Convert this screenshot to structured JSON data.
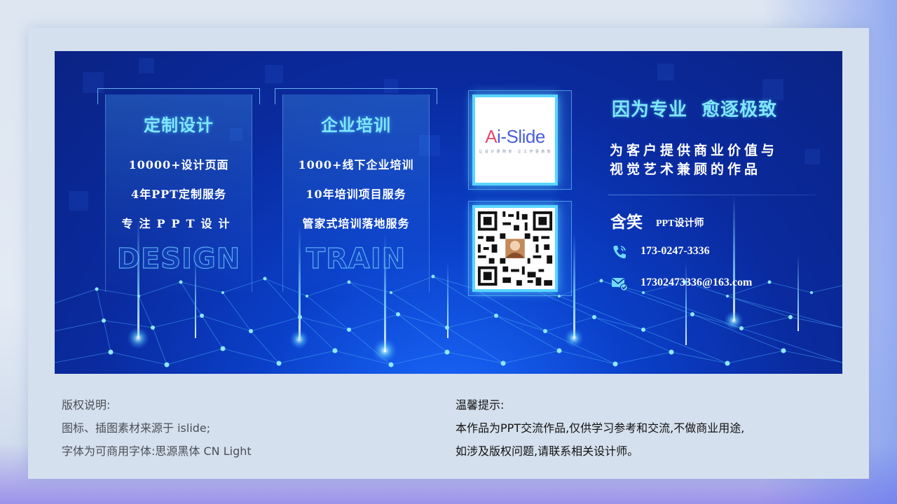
{
  "colors": {
    "banner_dark": "#0a2384",
    "banner_bright": "#1b6bff",
    "accent_cyan": "#7fe8ff",
    "glow": "#5ad6ff",
    "page_bg": "#d5e0ee"
  },
  "panels": [
    {
      "title": "定制设计",
      "lines": [
        "10000+设计页面",
        "4年PPT定制服务",
        "专注PPT设计"
      ],
      "watermark": "DESIGN"
    },
    {
      "title": "企业培训",
      "lines": [
        "1000+线下企业培训",
        "10年培训项目服务",
        "管家式培训落地服务"
      ],
      "watermark": "TRAIN"
    }
  ],
  "logo": {
    "text_a": "A",
    "text_rest": "i-Slide",
    "tagline": "让 设 计 更 简 单 · 让 工 作 更 高 效"
  },
  "qr": {
    "icon": "qr-code-icon"
  },
  "profile": {
    "slogan": "因为专业  愈逐极致",
    "value_lines": [
      "为客户提供商业价值与",
      "视觉艺术兼顾的作品"
    ],
    "name": "含笑",
    "role": "PPT设计师",
    "phone": "173-0247-3336",
    "email": "17302473336@163.com",
    "phone_icon": "phone-icon",
    "email_icon": "mail-icon"
  },
  "footer": {
    "copyright_title": "版权说明:",
    "copyright_lines": [
      "图标、插图素材来源于 islide;",
      "字体为可商用字体:思源黑体 CN Light"
    ],
    "tip_title": "温馨提示:",
    "tip_lines": [
      "本作品为PPT交流作品,仅供学习参考和交流,不做商业用途,",
      "如涉及版权问题,请联系相关设计师。"
    ]
  }
}
